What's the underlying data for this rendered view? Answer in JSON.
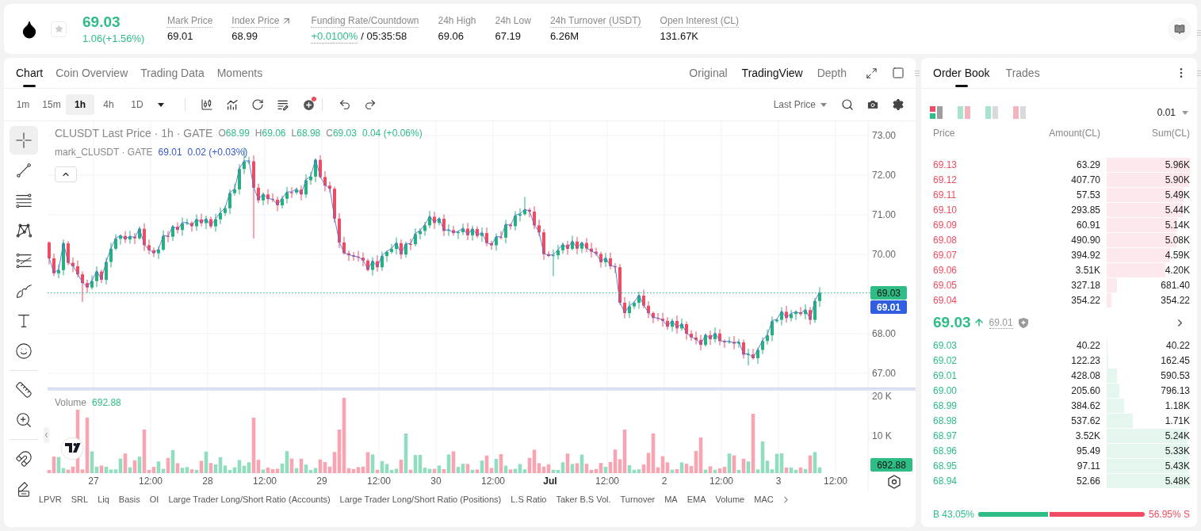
{
  "header": {
    "favorite": false,
    "price": "69.03",
    "change": "1.06(+1.56%)",
    "stats": [
      {
        "kind": "plain",
        "label": "Mark Price",
        "value": "69.01",
        "tooltip": true,
        "external": false
      },
      {
        "kind": "plain",
        "label": "Index Price",
        "value": "68.99",
        "tooltip": true,
        "external": true
      },
      {
        "kind": "funding",
        "label": "Funding Rate/Countdown",
        "value": "+0.0100%",
        "countdown": "/ 05:35:58",
        "tooltip": true,
        "external": false
      },
      {
        "kind": "plain",
        "label": "24h High",
        "value": "69.06",
        "tooltip": false,
        "external": false
      },
      {
        "kind": "plain",
        "label": "24h Low",
        "value": "67.19",
        "tooltip": false,
        "external": false
      },
      {
        "kind": "plain",
        "label": "24h Turnover (USDT)",
        "value": "6.26M",
        "tooltip": true,
        "external": false
      },
      {
        "kind": "plain",
        "label": "Open Interest (CL)",
        "value": "131.67K",
        "tooltip": true,
        "external": false
      }
    ]
  },
  "chart_panel": {
    "tabs": [
      {
        "label": "Chart",
        "selected": true
      },
      {
        "label": "Coin Overview",
        "selected": false
      },
      {
        "label": "Trading Data",
        "selected": false
      },
      {
        "label": "Moments",
        "selected": false
      }
    ],
    "views": [
      {
        "label": "Original",
        "selected": false
      },
      {
        "label": "TradingView",
        "selected": true
      },
      {
        "label": "Depth",
        "selected": false
      }
    ],
    "intervals": [
      {
        "label": "1m",
        "selected": false
      },
      {
        "label": "15m",
        "selected": false
      },
      {
        "label": "1h",
        "selected": true
      },
      {
        "label": "4h",
        "selected": false
      },
      {
        "label": "1D",
        "selected": false
      }
    ],
    "new_badge": true,
    "price_source": "Last Price",
    "tool_groups": [
      [
        {
          "kind": "crosshair",
          "selected": true
        },
        {
          "kind": "trend-line",
          "selected": false
        },
        {
          "kind": "fib",
          "selected": false
        },
        {
          "kind": "pattern",
          "selected": false
        },
        {
          "kind": "channel",
          "selected": false
        },
        {
          "kind": "brush",
          "selected": false
        },
        {
          "kind": "text",
          "selected": false
        },
        {
          "kind": "emoji",
          "selected": false
        }
      ],
      [
        {
          "kind": "ruler",
          "selected": false
        },
        {
          "kind": "zoom",
          "selected": false
        }
      ],
      [
        {
          "kind": "magnet",
          "selected": false
        },
        {
          "kind": "lock-drawing",
          "selected": false
        }
      ]
    ],
    "legend": {
      "title": "CLUSDT Last Price · 1h · GATE",
      "ohlc": [
        {
          "key": "O",
          "value": "68.99"
        },
        {
          "key": "H",
          "value": "69.06"
        },
        {
          "key": "L",
          "value": "68.98"
        },
        {
          "key": "C",
          "value": "69.03"
        }
      ],
      "change": "0.04 (+0.06%)"
    },
    "mark_legend": {
      "title": "mark_CLUSDT · GATE",
      "value": "69.01",
      "change": "0.02 (+0.03%)"
    },
    "price_axis": [
      "73.00",
      "72.00",
      "71.00",
      "70.00",
      "68.00",
      "67.00"
    ],
    "last_price_tag": "69.03",
    "mark_price_tag": "69.01",
    "volume": {
      "label": "Volume",
      "value": "692.88",
      "axis": [
        "20 K",
        "10 K"
      ],
      "last_tag": "692.88"
    },
    "time_axis": [
      {
        "label": "27",
        "kind": "date"
      },
      {
        "label": "12:00",
        "kind": "time"
      },
      {
        "label": "28",
        "kind": "date"
      },
      {
        "label": "12:00",
        "kind": "time"
      },
      {
        "label": "29",
        "kind": "date"
      },
      {
        "label": "12:00",
        "kind": "time"
      },
      {
        "label": "30",
        "kind": "date"
      },
      {
        "label": "12:00",
        "kind": "time"
      },
      {
        "label": "Jul",
        "kind": "month"
      },
      {
        "label": "12:00",
        "kind": "time"
      },
      {
        "label": "2",
        "kind": "date"
      },
      {
        "label": "12:00",
        "kind": "time"
      },
      {
        "label": "3",
        "kind": "date"
      },
      {
        "label": "12:00",
        "kind": "time"
      }
    ],
    "indicators": [
      "LPVR",
      "SRL",
      "Liq",
      "Basis",
      "OI",
      "Large Trader Long/Short Ratio (Accounts)",
      "Large Trader Long/Short Ratio (Positions)",
      "L.S Ratio",
      "Taker B.S Vol.",
      "Turnover",
      "MA",
      "EMA",
      "Volume",
      "MAC"
    ]
  },
  "order_book": {
    "tabs": [
      {
        "label": "Order Book",
        "selected": true
      },
      {
        "label": "Trades",
        "selected": false
      }
    ],
    "layouts": [
      {
        "kind": "both",
        "selected": true
      },
      {
        "kind": "split",
        "selected": false
      },
      {
        "kind": "bids",
        "selected": false
      },
      {
        "kind": "asks",
        "selected": false
      }
    ],
    "precision": "0.01",
    "columns": [
      "Price",
      "Amount(CL)",
      "Sum(CL)"
    ],
    "asks": [
      {
        "price": "69.13",
        "amount": "63.29",
        "sum": "5.96K",
        "level": 1.0
      },
      {
        "price": "69.12",
        "amount": "407.70",
        "sum": "5.90K",
        "level": 0.99
      },
      {
        "price": "69.11",
        "amount": "57.53",
        "sum": "5.49K",
        "level": 0.92
      },
      {
        "price": "69.10",
        "amount": "293.85",
        "sum": "5.44K",
        "level": 0.91
      },
      {
        "price": "69.09",
        "amount": "60.91",
        "sum": "5.14K",
        "level": 0.85
      },
      {
        "price": "69.08",
        "amount": "490.90",
        "sum": "5.08K",
        "level": 0.84
      },
      {
        "price": "69.07",
        "amount": "394.92",
        "sum": "4.59K",
        "level": 0.76
      },
      {
        "price": "69.06",
        "amount": "3.51K",
        "sum": "4.20K",
        "level": 0.7
      },
      {
        "price": "69.05",
        "amount": "327.18",
        "sum": "681.40",
        "level": 0.12
      },
      {
        "price": "69.04",
        "amount": "354.22",
        "sum": "354.22",
        "level": 0.06
      }
    ],
    "last_price": "69.03",
    "mark_price": "69.01",
    "bids": [
      {
        "price": "69.03",
        "amount": "40.22",
        "sum": "40.22",
        "level": 0.01
      },
      {
        "price": "69.02",
        "amount": "122.23",
        "sum": "162.45",
        "level": 0.02
      },
      {
        "price": "69.01",
        "amount": "428.08",
        "sum": "590.53",
        "level": 0.12
      },
      {
        "price": "69.00",
        "amount": "205.60",
        "sum": "796.13",
        "level": 0.15
      },
      {
        "price": "68.99",
        "amount": "384.62",
        "sum": "1.18K",
        "level": 0.21
      },
      {
        "price": "68.98",
        "amount": "537.62",
        "sum": "1.71K",
        "level": 0.31
      },
      {
        "price": "68.97",
        "amount": "3.52K",
        "sum": "5.24K",
        "level": 0.97
      },
      {
        "price": "68.96",
        "amount": "95.49",
        "sum": "5.33K",
        "level": 0.98
      },
      {
        "price": "68.95",
        "amount": "97.11",
        "sum": "5.43K",
        "level": 0.99
      },
      {
        "price": "68.94",
        "amount": "52.66",
        "sum": "5.48K",
        "level": 1.0
      }
    ],
    "ratio": {
      "buy": "B 43.05%",
      "sell": "56.95% S",
      "level": 0.4305
    }
  }
}
